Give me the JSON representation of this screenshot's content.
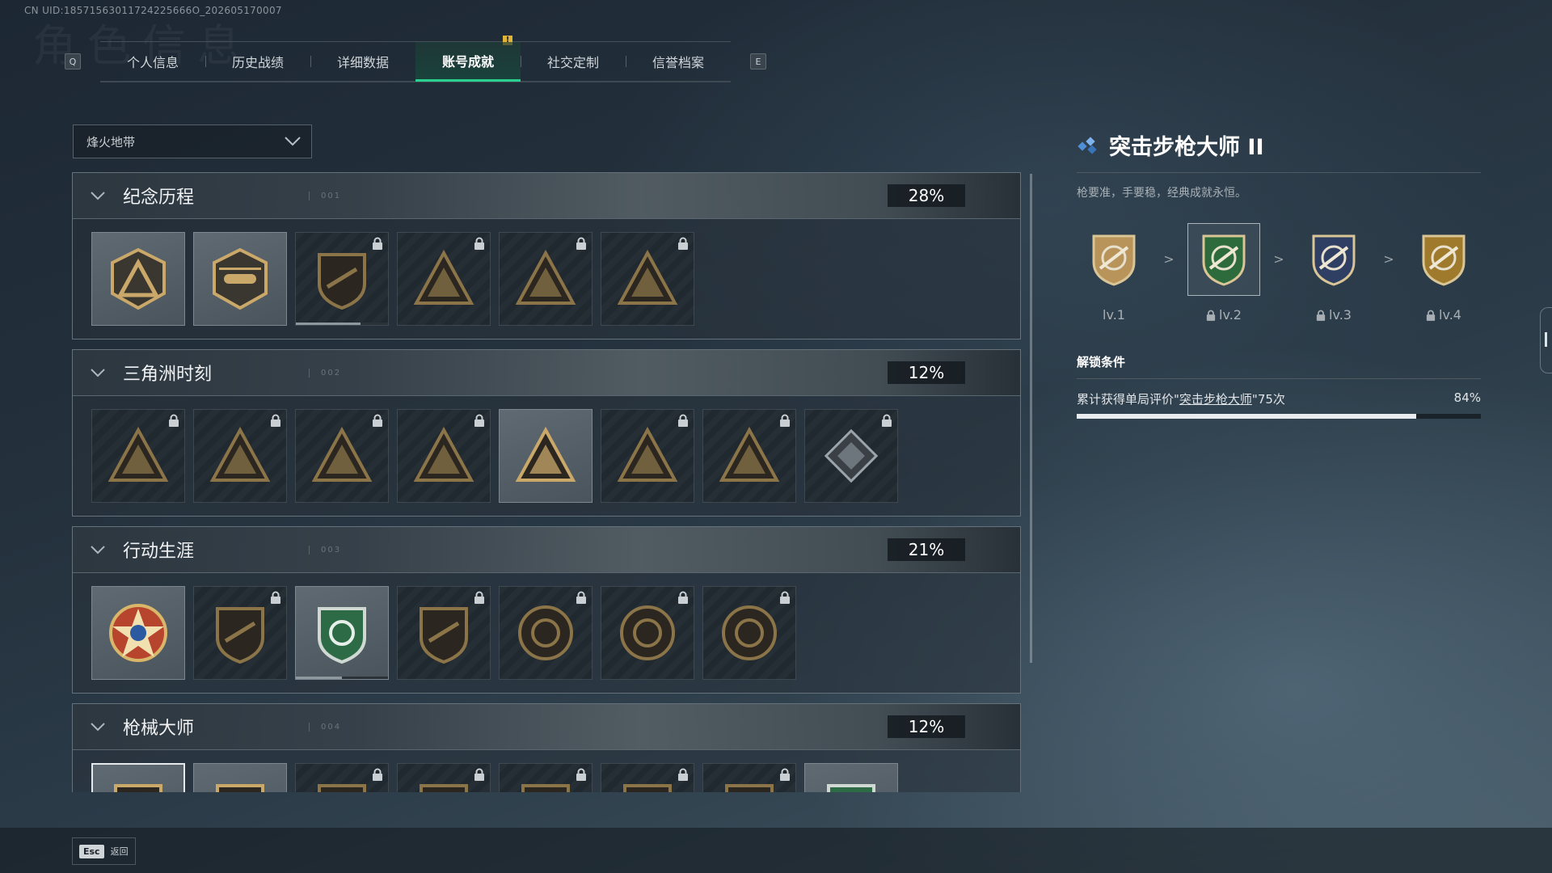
{
  "uid": "CN UID:18571563011724225666O_202605170007",
  "ghost_title": "角色信息",
  "tabs": {
    "prev_key": "Q",
    "next_key": "E",
    "items": [
      {
        "label": "个人信息",
        "active": false
      },
      {
        "label": "历史战绩",
        "active": false
      },
      {
        "label": "详细数据",
        "active": false
      },
      {
        "label": "账号成就",
        "active": true
      },
      {
        "label": "社交定制",
        "active": false
      },
      {
        "label": "信誉档案",
        "active": false
      }
    ],
    "alert_badge": "!"
  },
  "mode_select": {
    "value": "烽火地带"
  },
  "sections": [
    {
      "title": "纪念历程",
      "num": "001",
      "percent": "28%",
      "badges": [
        {
          "icon": "triangle-shield-badge",
          "locked": false
        },
        {
          "icon": "helicopter-badge",
          "locked": false
        },
        {
          "icon": "diamond-shield-badge",
          "locked": true,
          "progress": 0.7
        },
        {
          "icon": "castle-triangle-badge",
          "locked": true
        },
        {
          "icon": "skull-triangle-badge",
          "locked": true
        },
        {
          "icon": "soldier-triangle-badge",
          "locked": true
        }
      ]
    },
    {
      "title": "三角洲时刻",
      "num": "002",
      "percent": "12%",
      "badges": [
        {
          "icon": "crate-triangle-badge",
          "locked": true
        },
        {
          "icon": "tower-triangle-badge",
          "locked": true
        },
        {
          "icon": "runner-triangle-badge",
          "locked": true
        },
        {
          "icon": "dice-triangle-badge",
          "locked": true
        },
        {
          "icon": "squad-triangle-badge",
          "locked": false
        },
        {
          "icon": "beast-triangle-badge",
          "locked": true
        },
        {
          "icon": "fish-triangle-badge",
          "locked": true
        },
        {
          "icon": "diamond-box-badge",
          "locked": true
        }
      ]
    },
    {
      "title": "行动生涯",
      "num": "003",
      "percent": "21%",
      "badges": [
        {
          "icon": "star-emblem-badge",
          "locked": false
        },
        {
          "icon": "dark-shield-badge",
          "locked": true
        },
        {
          "icon": "green-shield-badge",
          "locked": false,
          "progress": 0.5
        },
        {
          "icon": "hex-shield-badge",
          "locked": true
        },
        {
          "icon": "circle-badge",
          "locked": true
        },
        {
          "icon": "skull-circle-badge",
          "locked": true
        },
        {
          "icon": "eye-circle-badge",
          "locked": true
        }
      ]
    },
    {
      "title": "枪械大师",
      "num": "004",
      "percent": "12%",
      "partial": true,
      "badges": [
        {
          "icon": "rifle-shield-badge",
          "locked": false,
          "selected": true
        },
        {
          "icon": "rifle-shield-badge",
          "locked": false
        },
        {
          "icon": "rifle-shield-badge",
          "locked": true
        },
        {
          "icon": "rifle-shield-badge",
          "locked": true
        },
        {
          "icon": "rifle-shield-badge",
          "locked": true
        },
        {
          "icon": "rifle-shield-badge",
          "locked": true
        },
        {
          "icon": "rifle-shield-badge",
          "locked": true
        },
        {
          "icon": "green-rifle-shield-badge",
          "locked": false
        }
      ]
    }
  ],
  "detail": {
    "title": "突击步枪大师 II",
    "description": "枪要准，手要稳，经典成就永恒。",
    "levels": [
      {
        "label": "lv.1",
        "locked": false,
        "color": "#b8935a"
      },
      {
        "label": "lv.2",
        "locked": true,
        "selected": true,
        "color": "#2d6b3c"
      },
      {
        "label": "lv.3",
        "locked": true,
        "color": "#2f3f63"
      },
      {
        "label": "lv.4",
        "locked": true,
        "color": "#a07a2c"
      }
    ],
    "level_arrow": ">",
    "unlock_title": "解锁条件",
    "condition_prefix": "累计获得单局评价\"",
    "condition_link": "突击步枪大师",
    "condition_suffix": "\"75次",
    "condition_percent": "84%",
    "condition_progress": 0.84
  },
  "bottom": {
    "esc_key": "Esc",
    "back_label": "返回"
  },
  "colors": {
    "accent_green": "#2ad08f",
    "gold": "#c9a86a",
    "alert": "#e0b436",
    "diamond_blue": "#4f8fd8"
  }
}
